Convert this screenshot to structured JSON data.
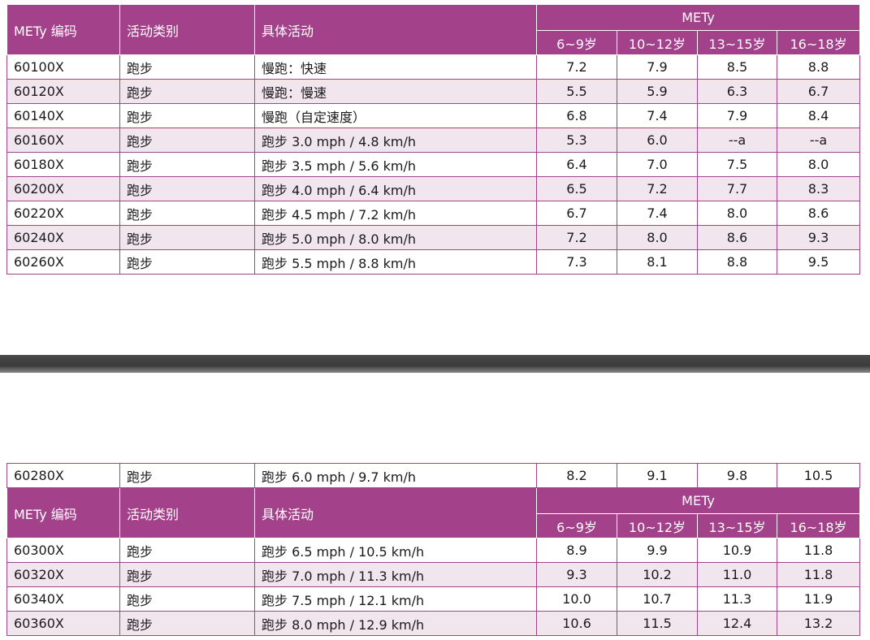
{
  "header": {
    "code": "METy 编码",
    "category": "活动类别",
    "activity": "具体活动",
    "group": "METy",
    "ages": [
      "6~9岁",
      "10~12岁",
      "13~15岁",
      "16~18岁"
    ]
  },
  "rows_top": [
    {
      "code": "60100X",
      "category": "跑步",
      "activity": "慢跑：快速",
      "v": [
        "7.2",
        "7.9",
        "8.5",
        "8.8"
      ]
    },
    {
      "code": "60120X",
      "category": "跑步",
      "activity": "慢跑：慢速",
      "v": [
        "5.5",
        "5.9",
        "6.3",
        "6.7"
      ]
    },
    {
      "code": "60140X",
      "category": "跑步",
      "activity": "慢跑（自定速度）",
      "v": [
        "6.8",
        "7.4",
        "7.9",
        "8.4"
      ]
    },
    {
      "code": "60160X",
      "category": "跑步",
      "activity": "跑步 3.0 mph / 4.8 km/h",
      "v": [
        "5.3",
        "6.0",
        "--a",
        "--a"
      ]
    },
    {
      "code": "60180X",
      "category": "跑步",
      "activity": "跑步 3.5 mph / 5.6 km/h",
      "v": [
        "6.4",
        "7.0",
        "7.5",
        "8.0"
      ]
    },
    {
      "code": "60200X",
      "category": "跑步",
      "activity": "跑步 4.0 mph / 6.4 km/h",
      "v": [
        "6.5",
        "7.2",
        "7.7",
        "8.3"
      ]
    },
    {
      "code": "60220X",
      "category": "跑步",
      "activity": "跑步 4.5 mph / 7.2 km/h",
      "v": [
        "6.7",
        "7.4",
        "8.0",
        "8.6"
      ]
    },
    {
      "code": "60240X",
      "category": "跑步",
      "activity": "跑步 5.0 mph / 8.0 km/h",
      "v": [
        "7.2",
        "8.0",
        "8.6",
        "9.3"
      ]
    },
    {
      "code": "60260X",
      "category": "跑步",
      "activity": "跑步 5.5 mph / 8.8 km/h",
      "v": [
        "7.3",
        "8.1",
        "8.8",
        "9.5"
      ]
    }
  ],
  "row_carry": {
    "code": "60280X",
    "category": "跑步",
    "activity": "跑步 6.0 mph / 9.7 km/h",
    "v": [
      "8.2",
      "9.1",
      "9.8",
      "10.5"
    ]
  },
  "rows_bottom": [
    {
      "code": "60300X",
      "category": "跑步",
      "activity": "跑步 6.5 mph / 10.5 km/h",
      "v": [
        "8.9",
        "9.9",
        "10.9",
        "11.8"
      ]
    },
    {
      "code": "60320X",
      "category": "跑步",
      "activity": "跑步 7.0 mph / 11.3 km/h",
      "v": [
        "9.3",
        "10.2",
        "11.0",
        "11.8"
      ]
    },
    {
      "code": "60340X",
      "category": "跑步",
      "activity": "跑步 7.5 mph / 12.1 km/h",
      "v": [
        "10.0",
        "10.7",
        "11.3",
        "11.9"
      ]
    },
    {
      "code": "60360X",
      "category": "跑步",
      "activity": "跑步 8.0 mph / 12.9 km/h",
      "v": [
        "10.6",
        "11.5",
        "12.4",
        "13.2"
      ]
    }
  ]
}
